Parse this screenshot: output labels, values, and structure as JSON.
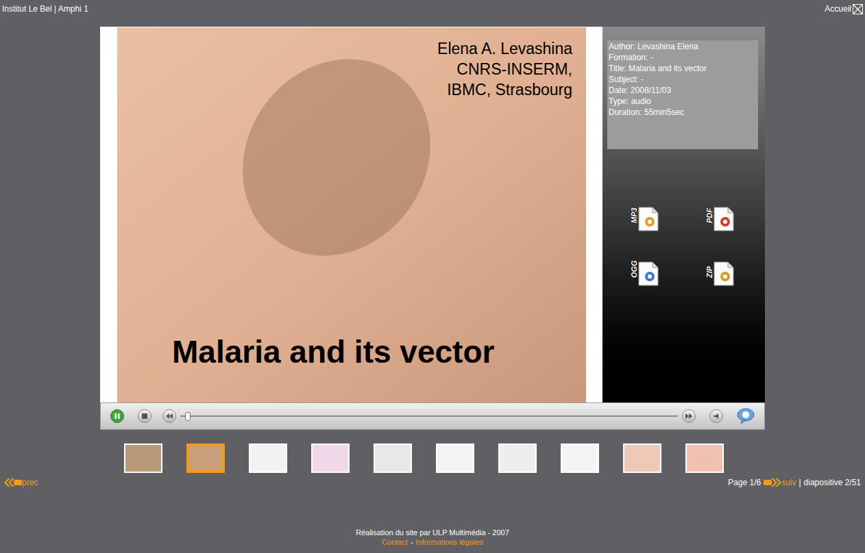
{
  "header": {
    "left": "Institut Le Bel | Amphi 1",
    "right": "Accueil"
  },
  "slide": {
    "lines": [
      "Elena A. Levashina",
      "CNRS-INSERM,",
      "IBMC, Strasbourg"
    ],
    "title": "Malaria and its vector"
  },
  "info": [
    "Author: Levashina Elena",
    "Formation: -",
    "Title: Malaria and its vector",
    "Subject: -",
    "Date: 2008/11/03",
    "Type: audio",
    "Duration: 55min5sec"
  ],
  "downloads": [
    {
      "label": "MP3",
      "color": "#e39a2c"
    },
    {
      "label": "PDF",
      "color": "#d83a2a"
    },
    {
      "label": "OGG",
      "color": "#4a78c8"
    },
    {
      "label": "ZIP",
      "color": "#c9a02a"
    }
  ],
  "player": {
    "playing": true,
    "level": 0.01
  },
  "thumbnails": [
    {
      "selected": false,
      "color": "#b89a78"
    },
    {
      "selected": true,
      "color": "#c8a07c"
    },
    {
      "selected": false,
      "color": "#f2f2f2"
    },
    {
      "selected": false,
      "color": "#f0d8e8"
    },
    {
      "selected": false,
      "color": "#e8e8e8"
    },
    {
      "selected": false,
      "color": "#f4f4f4"
    },
    {
      "selected": false,
      "color": "#eeeeee"
    },
    {
      "selected": false,
      "color": "#f4f4f4"
    },
    {
      "selected": false,
      "color": "#f0c8b8"
    },
    {
      "selected": false,
      "color": "#f0c0b0"
    }
  ],
  "nav": {
    "prev": "prec",
    "page": "Page 1/6",
    "next": "suiv",
    "separator": "|",
    "slide_count": "diapositive 2/51"
  },
  "footer": {
    "credit": "Réalisation du site par ULP Multimédia - 2007",
    "links": [
      "Contact",
      "Informations légales"
    ],
    "separator": "-"
  }
}
